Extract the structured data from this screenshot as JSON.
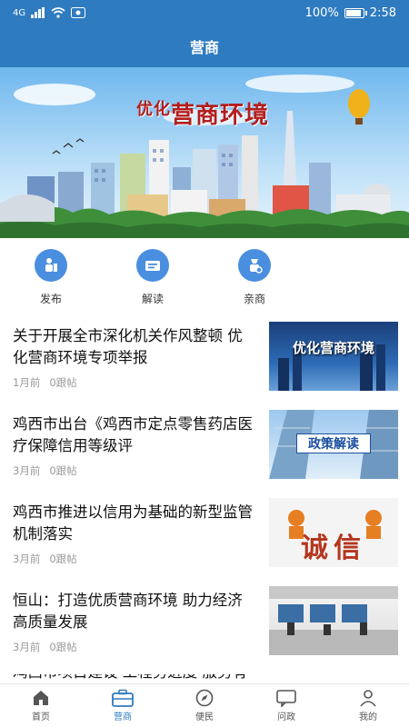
{
  "status_bar": {
    "signal": "4G",
    "battery": "100%",
    "battery_level": 1.0,
    "time": "2:58"
  },
  "header": {
    "title": "营商"
  },
  "banner": {
    "title_small": "优化",
    "title_main": "营商环境"
  },
  "quick_actions": [
    {
      "label": "发布",
      "icon": "publish-icon"
    },
    {
      "label": "解读",
      "icon": "interpret-icon"
    },
    {
      "label": "亲商",
      "icon": "pro-business-icon"
    }
  ],
  "news": [
    {
      "title": "关于开展全市深化机关作风整顿 优化营商环境专项举报",
      "time": "1月前",
      "replies": "0跟帖",
      "thumb_text": "优化营商环境"
    },
    {
      "title": "鸡西市出台《鸡西市定点零售药店医疗保障信用等级评",
      "time": "3月前",
      "replies": "0跟帖",
      "thumb_text": "政策解读"
    },
    {
      "title": "鸡西市推进以信用为基础的新型监管机制落实",
      "time": "3月前",
      "replies": "0跟帖",
      "thumb_text": "诚信"
    },
    {
      "title": "恒山：打造优质营商环境 助力经济高质量发展",
      "time": "3月前",
      "replies": "0跟帖",
      "thumb_text": ""
    },
    {
      "title": "鸡西市项目建设 工程务进度 服务有温度 发展",
      "time": "",
      "replies": "",
      "thumb_text": ""
    }
  ],
  "tabs": [
    {
      "label": "首页",
      "icon": "home-icon",
      "active": false
    },
    {
      "label": "营商",
      "icon": "briefcase-icon",
      "active": true
    },
    {
      "label": "便民",
      "icon": "compass-icon",
      "active": false
    },
    {
      "label": "问政",
      "icon": "chat-icon",
      "active": false
    },
    {
      "label": "我的",
      "icon": "user-icon",
      "active": false
    }
  ],
  "colors": {
    "primary": "#2f7bc0",
    "icon_blue": "#4a8ee0",
    "banner_red": "#b21e1e"
  }
}
